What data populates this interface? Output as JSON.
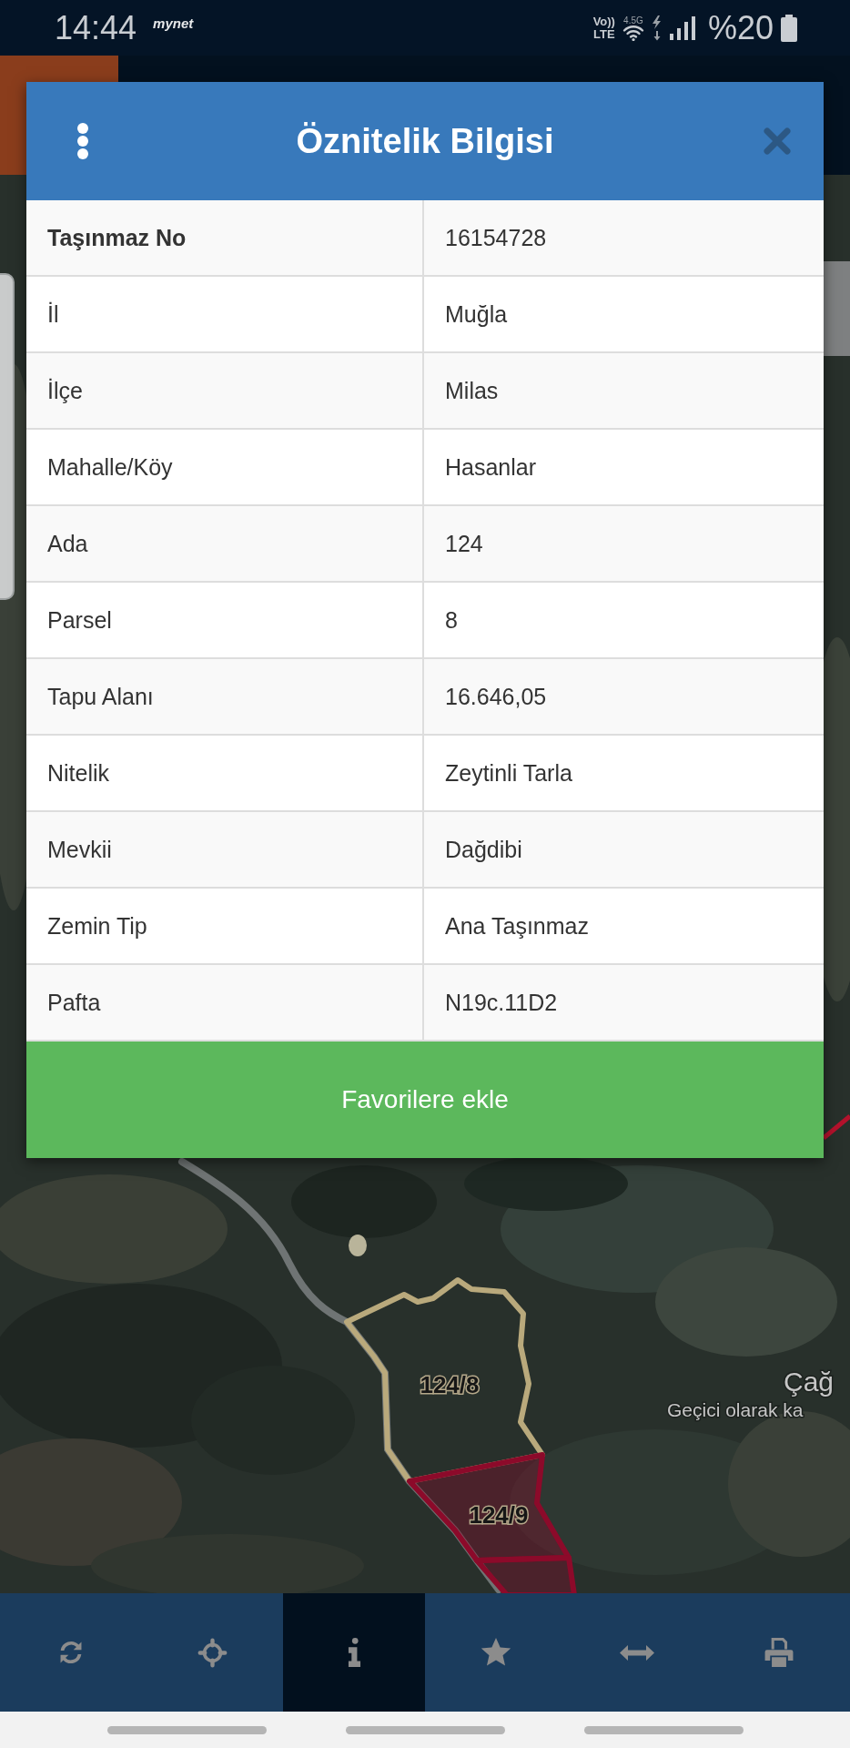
{
  "status_bar": {
    "time": "14:44",
    "logo": "mynet",
    "volte": [
      "Vo))",
      "LTE"
    ],
    "network": "4.5G",
    "battery": "%20"
  },
  "dialog": {
    "title": "Öznitelik Bilgisi",
    "rows": [
      {
        "label": "Taşınmaz No",
        "value": "16154728",
        "bold": true
      },
      {
        "label": "İl",
        "value": "Muğla",
        "bold": false
      },
      {
        "label": "İlçe",
        "value": "Milas",
        "bold": false
      },
      {
        "label": "Mahalle/Köy",
        "value": "Hasanlar",
        "bold": false
      },
      {
        "label": "Ada",
        "value": "124",
        "bold": false
      },
      {
        "label": "Parsel",
        "value": "8",
        "bold": false
      },
      {
        "label": "Tapu Alanı",
        "value": "16.646,05",
        "bold": false
      },
      {
        "label": "Nitelik",
        "value": "Zeytinli Tarla",
        "bold": false
      },
      {
        "label": "Mevkii",
        "value": "Dağdibi",
        "bold": false
      },
      {
        "label": "Zemin Tip",
        "value": "Ana Taşınmaz",
        "bold": false
      },
      {
        "label": "Pafta",
        "value": "N19c.11D2",
        "bold": false
      }
    ],
    "button": "Favorilere ekle"
  },
  "map": {
    "parcels": [
      {
        "label": "124/8",
        "color": "#b9a97c",
        "kind": "outline"
      },
      {
        "label": "124/9",
        "color": "#8c0a2a",
        "kind": "filled"
      },
      {
        "color": "#8c0a2a",
        "kind": "filled"
      },
      {
        "color": "#b3122c",
        "kind": "outline"
      }
    ],
    "place_labels": [
      "Çağ",
      "Geçici olarak ka"
    ]
  },
  "bottom_nav": [
    {
      "kind": "refresh",
      "selected": false
    },
    {
      "kind": "crosshair",
      "selected": false
    },
    {
      "kind": "info",
      "selected": true
    },
    {
      "kind": "star",
      "selected": false
    },
    {
      "kind": "arrows",
      "selected": false
    },
    {
      "kind": "print",
      "selected": false
    }
  ]
}
